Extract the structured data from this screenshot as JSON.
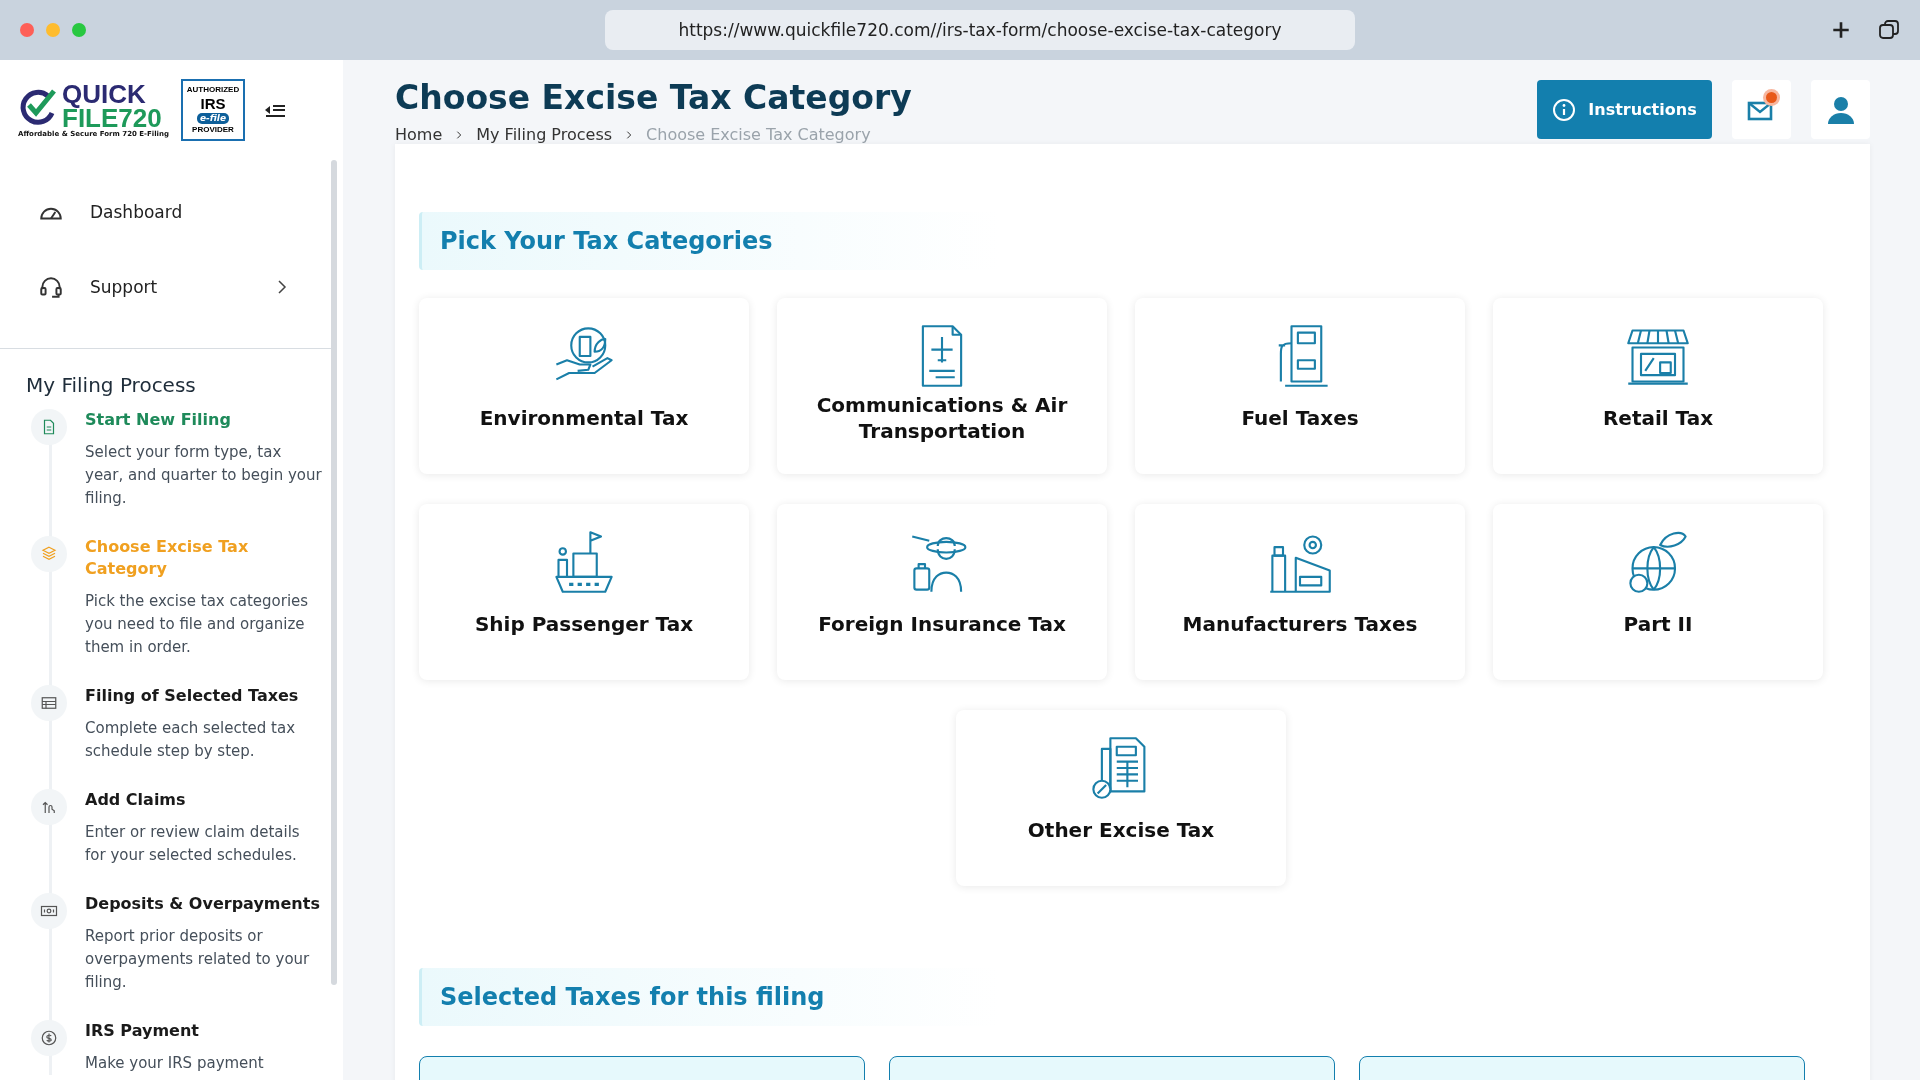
{
  "browser": {
    "url": "https://www.quickfile720.com//irs-tax-form/choose-excise-tax-category"
  },
  "sidebar": {
    "logo": {
      "name_top": "QUICK",
      "name_bottom": "FILE720",
      "tagline": "Affordable & Secure Form 720 E-Filing"
    },
    "badge": {
      "top": "AUTHORIZED",
      "main": "IRS",
      "middle": "e-file",
      "bottom": "PROVIDER"
    },
    "nav": [
      {
        "label": "Dashboard",
        "expandable": false
      },
      {
        "label": "Support",
        "expandable": true
      }
    ],
    "process_title": "My Filing Process",
    "steps": [
      {
        "title": "Start New Filing",
        "description": "Select your form type, tax year, and quarter to begin your filing.",
        "completed": true,
        "selected": false
      },
      {
        "title": "Choose Excise Tax Category",
        "description": "Pick the excise tax categories you need to file and organize them in order.",
        "completed": false,
        "selected": true
      },
      {
        "title": "Filing of Selected Taxes",
        "description": "Complete each selected tax schedule step by step.",
        "completed": false,
        "selected": false
      },
      {
        "title": "Add Claims",
        "description": "Enter or review claim details for your selected schedules.",
        "completed": false,
        "selected": false
      },
      {
        "title": "Deposits & Overpayments",
        "description": "Report prior deposits or overpayments related to your filing.",
        "completed": false,
        "selected": false
      },
      {
        "title": "IRS Payment",
        "description": "Make your IRS payment",
        "completed": false,
        "selected": false
      }
    ]
  },
  "header": {
    "title": "Choose Excise Tax Category",
    "breadcrumb": [
      "Home",
      "My Filing Process",
      "Choose Excise Tax Category"
    ],
    "instructions_button": "Instructions",
    "mail_unread": true
  },
  "categories_section": {
    "title": "Pick Your Tax Categories",
    "categories": [
      {
        "label": "Environmental Tax"
      },
      {
        "label": "Communications & Air Transportation"
      },
      {
        "label": "Fuel Taxes"
      },
      {
        "label": "Retail Tax"
      },
      {
        "label": "Ship Passenger Tax"
      },
      {
        "label": "Foreign Insurance Tax"
      },
      {
        "label": "Manufacturers Taxes"
      },
      {
        "label": "Part II"
      },
      {
        "label": "Other Excise Tax"
      }
    ]
  },
  "selected_section": {
    "title": "Selected Taxes for this filing"
  }
}
